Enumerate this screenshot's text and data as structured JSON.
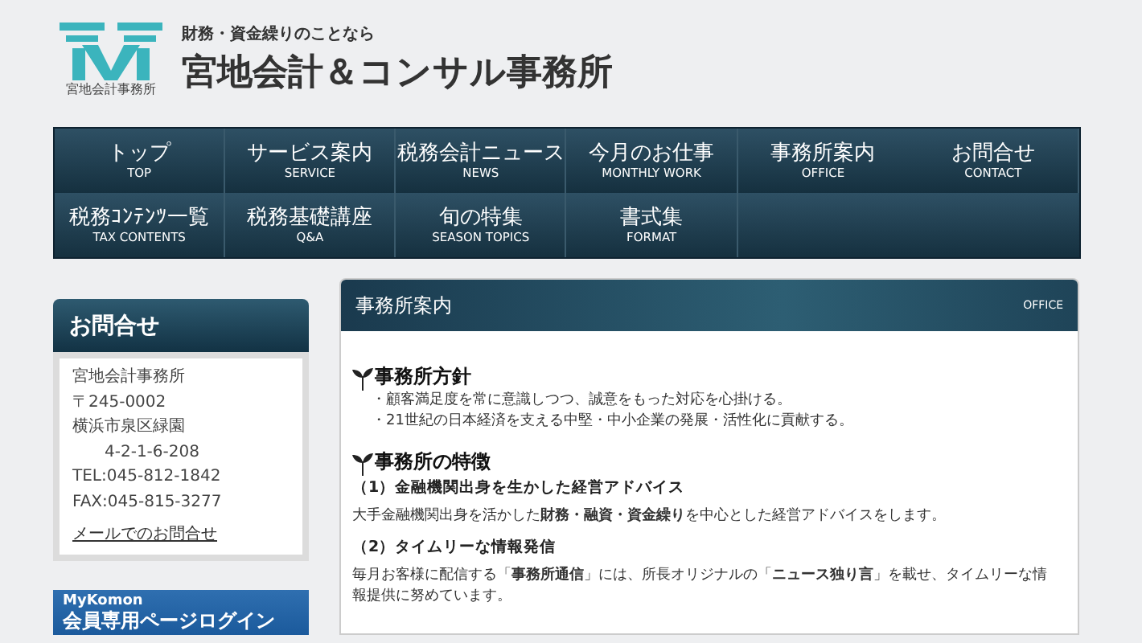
{
  "header": {
    "logo_caption": "宮地会計事務所",
    "tagline": "財務・資金繰りのことなら",
    "site_title": "宮地会計＆コンサル事務所"
  },
  "nav": [
    {
      "label": "トップ",
      "sublabel": "TOP"
    },
    {
      "label": "サービス案内",
      "sublabel": "SERVICE"
    },
    {
      "label": "税務会計ニュース",
      "sublabel": "NEWS"
    },
    {
      "label": "今月のお仕事",
      "sublabel": "MONTHLY WORK"
    },
    {
      "label": "事務所案内",
      "sublabel": "OFFICE"
    },
    {
      "label": "お問合せ",
      "sublabel": "CONTACT"
    },
    {
      "label": "税務ｺﾝﾃﾝﾂ一覧",
      "sublabel": "TAX CONTENTS"
    },
    {
      "label": "税務基礎講座",
      "sublabel": "Q&A"
    },
    {
      "label": "旬の特集",
      "sublabel": "SEASON TOPICS"
    },
    {
      "label": "書式集",
      "sublabel": "FORMAT"
    }
  ],
  "sidebar": {
    "contact": {
      "title": "お問合せ",
      "lines": [
        {
          "text": "宮地会計事務所",
          "indent": false
        },
        {
          "text": "〒245-0002",
          "indent": false
        },
        {
          "text": "横浜市泉区緑園",
          "indent": false
        },
        {
          "text": "4-2-1-6-208",
          "indent": true
        },
        {
          "text": "TEL:045-812-1842",
          "indent": false
        },
        {
          "text": "FAX:045-815-3277",
          "indent": false
        }
      ],
      "link": "メールでのお問合せ"
    },
    "banner": {
      "brand": "MyKomon",
      "label": "会員専用ページログイン"
    }
  },
  "main": {
    "title": "事務所案内",
    "title_en": "OFFICE",
    "sections": [
      {
        "heading": "事務所方針",
        "items": [
          {
            "kind": "bullet",
            "text": "・顧客満足度を常に意識しつつ、誠意をもった対応を心掛ける。"
          },
          {
            "kind": "bullet",
            "text": "・21世紀の日本経済を支える中堅・中小企業の発展・活性化に貢献する。"
          }
        ]
      },
      {
        "heading": "事務所の特徴",
        "points": [
          {
            "title": "（1）金融機関出身を生かした経営アドバイス",
            "text": "大手金融機関出身を活かした**財務・融資・資金繰り**を中心とした経営アドバイスをします。"
          },
          {
            "title": "（2）タイムリーな情報発信",
            "text": "毎月お客様に配信する「**事務所通信**」には、所長オリジナルの「**ニュース独り言**」を載せ、タイムリーな情報提供に努めています。"
          }
        ]
      }
    ]
  }
}
